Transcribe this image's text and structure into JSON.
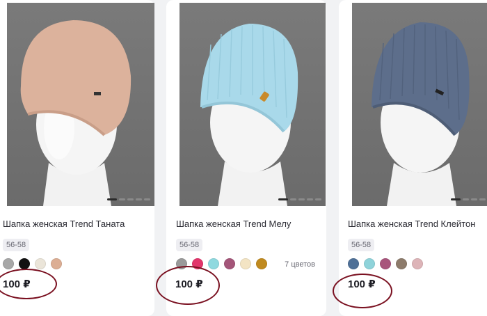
{
  "products": [
    {
      "title": "Шапка женская Trend Таната",
      "size": "56-58",
      "price": "100 ₽",
      "hat_color": "#dcb29c",
      "swatches": [
        "#a7a7a7",
        "#111111",
        "#ebe5d9",
        "#dcae94"
      ],
      "colors_count": ""
    },
    {
      "title": "Шапка женская Trend Мелу",
      "size": "56-58",
      "price": "100 ₽",
      "hat_color": "#a9d9ea",
      "swatches": [
        "#9a9a9a",
        "#e2356b",
        "#8fd9df",
        "#a45579",
        "#f3e4c4",
        "#c08a1f"
      ],
      "colors_count": "7 цветов"
    },
    {
      "title": "Шапка женская Trend Клейтон",
      "size": "56-58",
      "price": "100 ₽",
      "hat_color": "#5d6e8b",
      "swatches": [
        "#4f7097",
        "#8fd3da",
        "#a8557c",
        "#8d7b6b",
        "#ddb4b8"
      ],
      "colors_count": ""
    }
  ],
  "annotation_color": "#7a1020"
}
